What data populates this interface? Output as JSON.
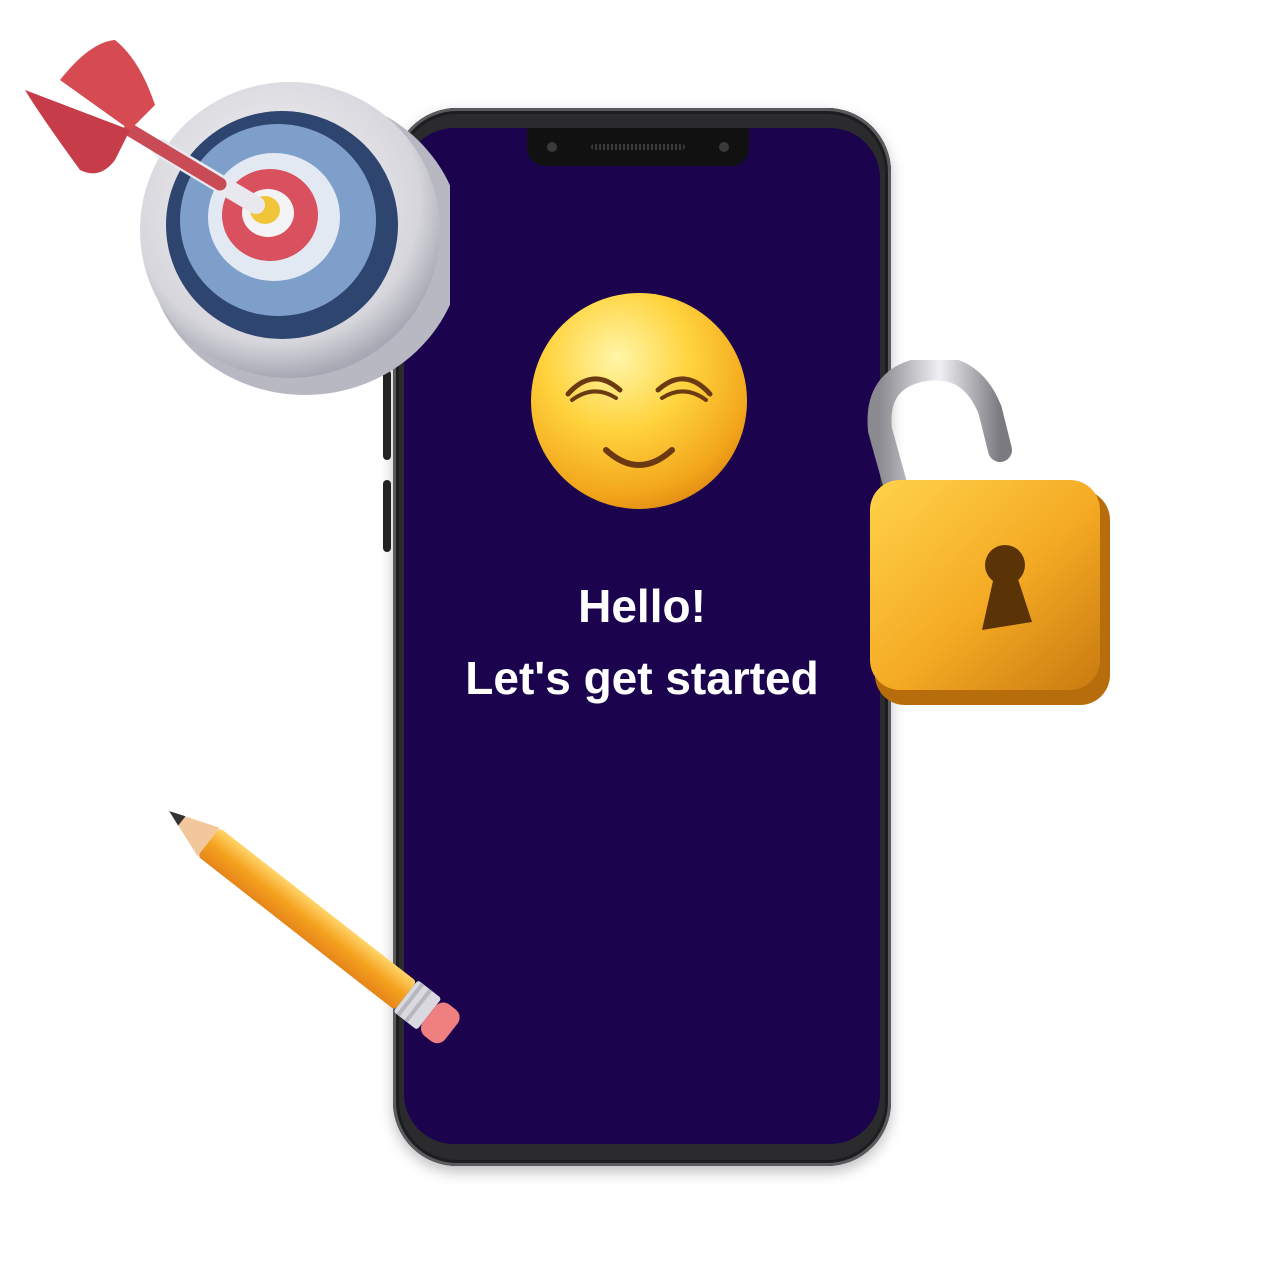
{
  "screen": {
    "greeting_line1": "Hello!",
    "greeting_line2": "Let's get started"
  },
  "icons": {
    "emoji": "smiling-face-icon",
    "target": "dart-target-icon",
    "lock": "unlocked-padlock-icon",
    "pencil": "pencil-icon"
  },
  "colors": {
    "screen_background": "#1b044d",
    "text": "#ffffff",
    "phone_frame": "#2b2b2d"
  }
}
